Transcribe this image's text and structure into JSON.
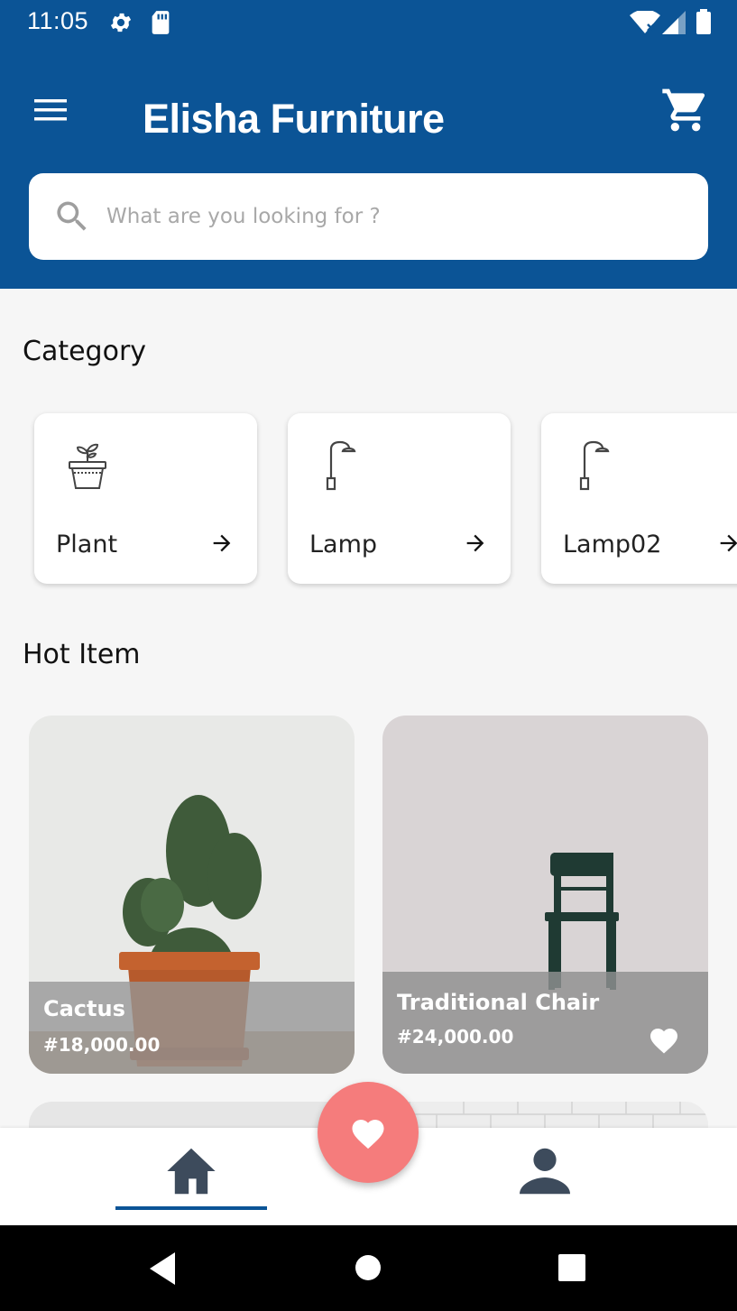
{
  "status_bar": {
    "time": "11:05",
    "icons": [
      "settings-icon",
      "sd-card-icon",
      "wifi-icon",
      "signal-icon",
      "battery-icon"
    ]
  },
  "app_bar": {
    "title": "Elisha Furniture",
    "menu_icon": "menu-icon",
    "cart_icon": "cart-icon"
  },
  "search": {
    "placeholder": "What are you looking for ?",
    "value": ""
  },
  "categories": {
    "title": "Category",
    "items": [
      {
        "label": "Plant",
        "icon": "plant-pot-icon"
      },
      {
        "label": "Lamp",
        "icon": "lamp-icon"
      },
      {
        "label": "Lamp02",
        "icon": "lamp-icon"
      }
    ]
  },
  "hot_items": {
    "title": "Hot Item",
    "items": [
      {
        "name": "Cactus",
        "price": "#18,000.00",
        "favorited": false
      },
      {
        "name": "Traditional Chair",
        "price": "#24,000.00",
        "favorited": true
      }
    ]
  },
  "bottom_nav": {
    "items": [
      "home-icon",
      "favorite-icon",
      "profile-icon"
    ],
    "active": "home"
  },
  "colors": {
    "primary": "#0b5496",
    "fab": "#f57c7c",
    "background": "#f6f6f6"
  }
}
